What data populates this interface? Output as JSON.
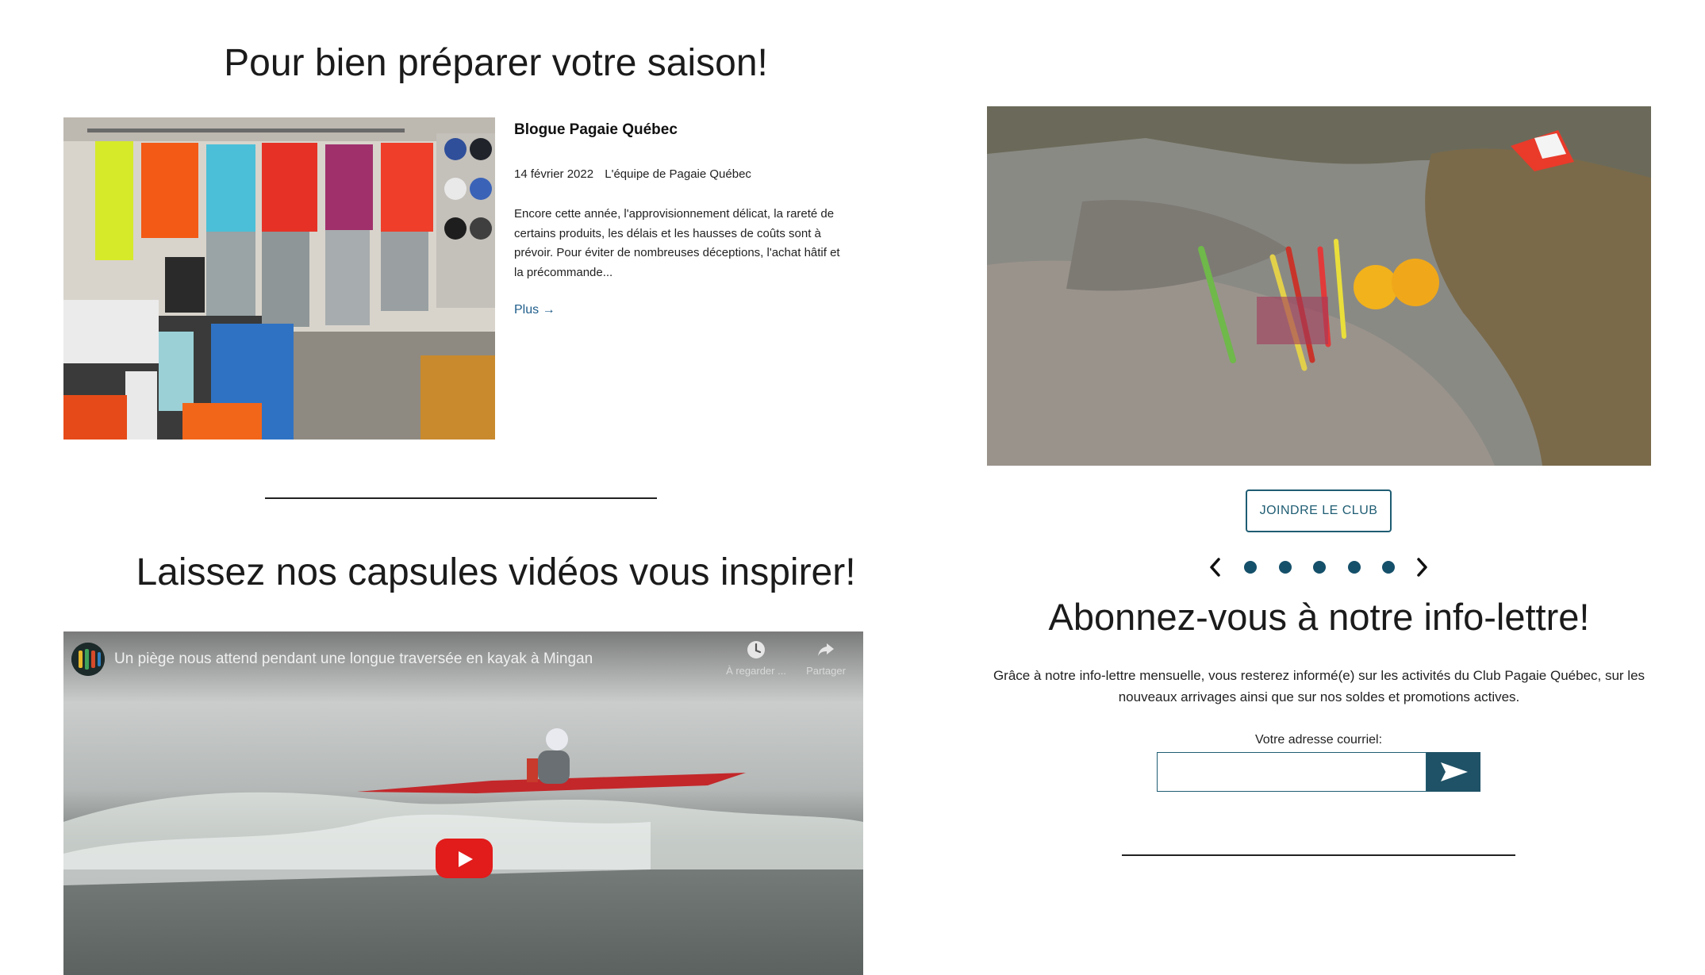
{
  "blog_section": {
    "heading": "Pour bien préparer votre saison!",
    "post": {
      "title": "Blogue Pagaie Québec",
      "date": "14 février 2022",
      "author": "L'équipe de Pagaie Québec",
      "excerpt": "Encore cette année, l'approvisionnement délicat, la rareté de certains produits, les délais et les hausses de coûts sont à prévoir. Pour éviter de nombreuses déceptions, l'achat hâtif et la précommande...",
      "more_label": "Plus →"
    }
  },
  "video_section": {
    "heading": "Laissez nos capsules vidéos vous inspirer!",
    "video": {
      "title": "Un piège nous attend pendant une longue traversée en kayak à Mingan",
      "watch_later_label": "À regarder ...",
      "share_label": "Partager"
    }
  },
  "club": {
    "join_label": "JOINDRE LE CLUB",
    "carousel": {
      "slide_count": 5,
      "active_index": 0
    }
  },
  "newsletter": {
    "heading": "Abonnez-vous à notre info-lettre!",
    "description": "Grâce à notre info-lettre mensuelle, vous resterez informé(e) sur les activités du Club Pagaie Québec,  sur les nouveaux arrivages ainsi que sur nos soldes et promotions actives.",
    "email_label": "Votre adresse courriel:",
    "email_value": "",
    "submit_icon": "send-arrow-icon"
  },
  "colors": {
    "accent": "#1f5d73",
    "link": "#1f5d8a",
    "dot": "#15506a",
    "youtube_red": "#e21b1b"
  }
}
